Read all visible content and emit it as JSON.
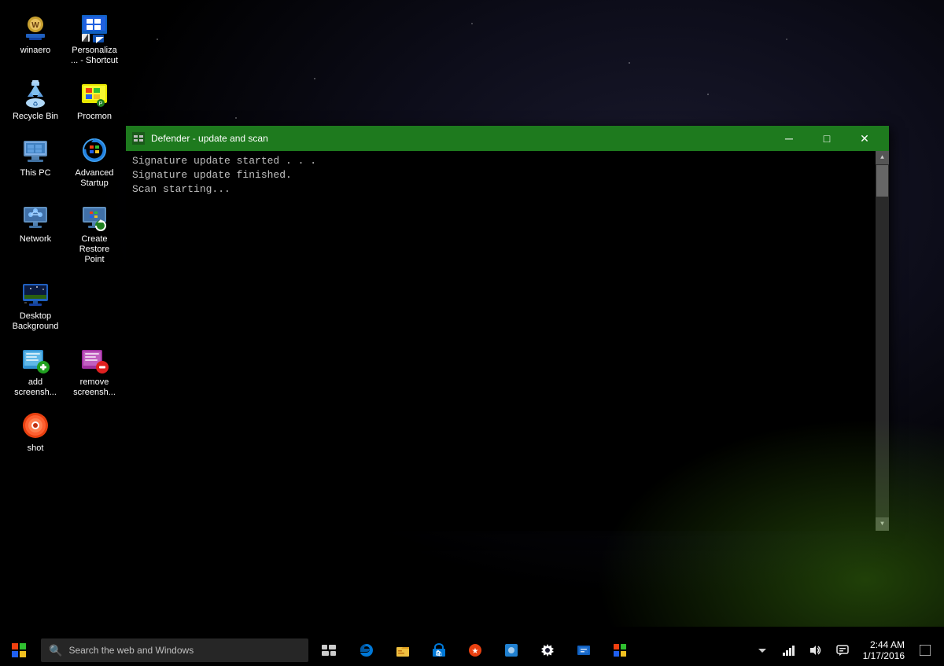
{
  "desktop": {
    "icons": [
      {
        "id": "winaero",
        "label": "winaero",
        "row": 0,
        "col": 0,
        "icon_type": "winaero"
      },
      {
        "id": "personalize",
        "label": "Personaliza... - Shortcut",
        "row": 0,
        "col": 1,
        "icon_type": "personalize"
      },
      {
        "id": "recycle",
        "label": "Recycle Bin",
        "row": 1,
        "col": 0,
        "icon_type": "recycle"
      },
      {
        "id": "procmon",
        "label": "Procmon",
        "row": 1,
        "col": 1,
        "icon_type": "procmon"
      },
      {
        "id": "thispc",
        "label": "This PC",
        "row": 2,
        "col": 0,
        "icon_type": "thispc"
      },
      {
        "id": "advanced-startup",
        "label": "Advanced Startup",
        "row": 2,
        "col": 1,
        "icon_type": "advanced-startup"
      },
      {
        "id": "network",
        "label": "Network",
        "row": 3,
        "col": 0,
        "icon_type": "network"
      },
      {
        "id": "create-restore",
        "label": "Create Restore Point",
        "row": 3,
        "col": 1,
        "icon_type": "restore"
      },
      {
        "id": "desktop-bg",
        "label": "Desktop Background",
        "row": 4,
        "col": 0,
        "icon_type": "desktop-bg"
      },
      {
        "id": "add-screenshot",
        "label": "add screensh...",
        "row": 5,
        "col": 0,
        "icon_type": "add-screenshot"
      },
      {
        "id": "remove-screenshot",
        "label": "remove screensh...",
        "row": 5,
        "col": 1,
        "icon_type": "remove-screenshot"
      },
      {
        "id": "shot",
        "label": "shot",
        "row": 6,
        "col": 0,
        "icon_type": "shot"
      }
    ]
  },
  "cmd_window": {
    "title": "Defender - update and scan",
    "lines": [
      "Signature update started . . .",
      "Signature update finished.",
      "Scan starting..."
    ],
    "minimize_label": "─",
    "maximize_label": "□",
    "close_label": "✕"
  },
  "taskbar": {
    "search_placeholder": "Search the web and Windows",
    "clock_time": "2:44 AM",
    "clock_date": "1/17/2016",
    "apps": [
      {
        "id": "edge",
        "label": "Microsoft Edge"
      },
      {
        "id": "explorer",
        "label": "File Explorer"
      },
      {
        "id": "store",
        "label": "Store"
      },
      {
        "id": "app5",
        "label": "App 5"
      },
      {
        "id": "app6",
        "label": "App 6"
      },
      {
        "id": "settings",
        "label": "Settings"
      },
      {
        "id": "app8",
        "label": "App 8"
      },
      {
        "id": "app9",
        "label": "App 9"
      }
    ]
  }
}
